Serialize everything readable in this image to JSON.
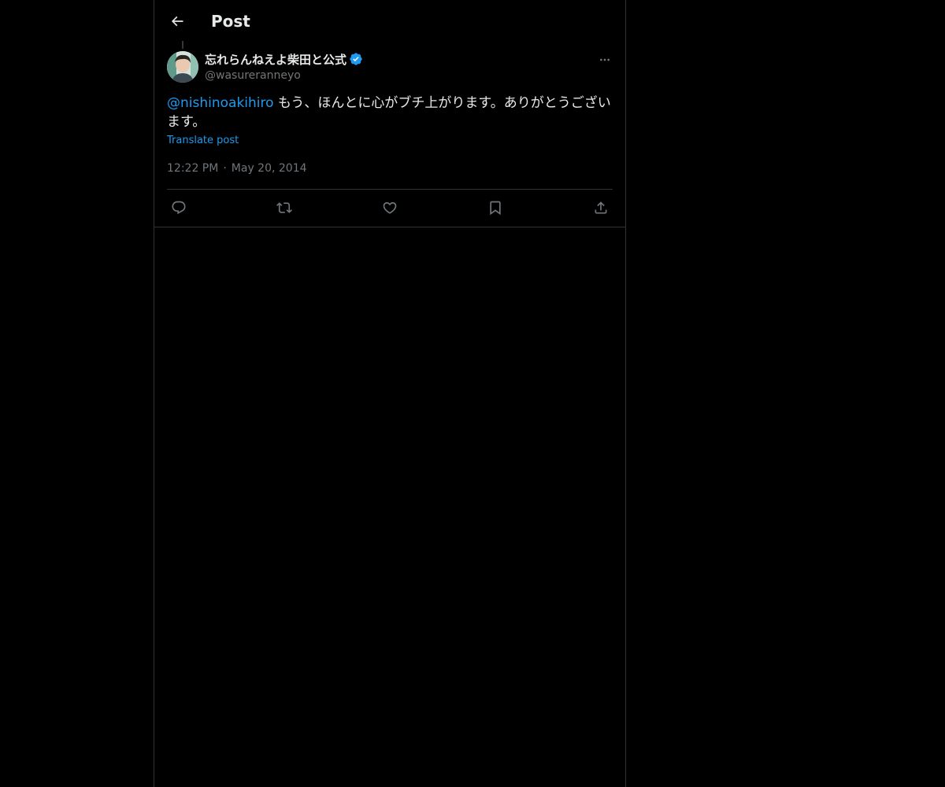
{
  "header": {
    "back_icon": "arrow-left-icon",
    "title": "Post"
  },
  "post": {
    "author": {
      "display_name": "忘れらんねえよ柴田と公式",
      "handle": "@wasureranneyo",
      "verified": true,
      "verified_color": "#1d9bf0"
    },
    "text": {
      "mention": "@nishinoakihiro",
      "body": " もう、ほんとに心がブチ上がります。ありがとうございます。"
    },
    "translate_label": "Translate post",
    "time": "12:22 PM",
    "separator": "·",
    "date": "May 20, 2014"
  },
  "actions": [
    {
      "icon": "reply-icon"
    },
    {
      "icon": "repost-icon"
    },
    {
      "icon": "like-icon"
    },
    {
      "icon": "bookmark-icon"
    },
    {
      "icon": "share-icon"
    }
  ],
  "colors": {
    "background": "#000000",
    "text": "#e7e9ea",
    "secondary": "#71767b",
    "accent": "#1d9bf0",
    "border": "#2f3336"
  }
}
